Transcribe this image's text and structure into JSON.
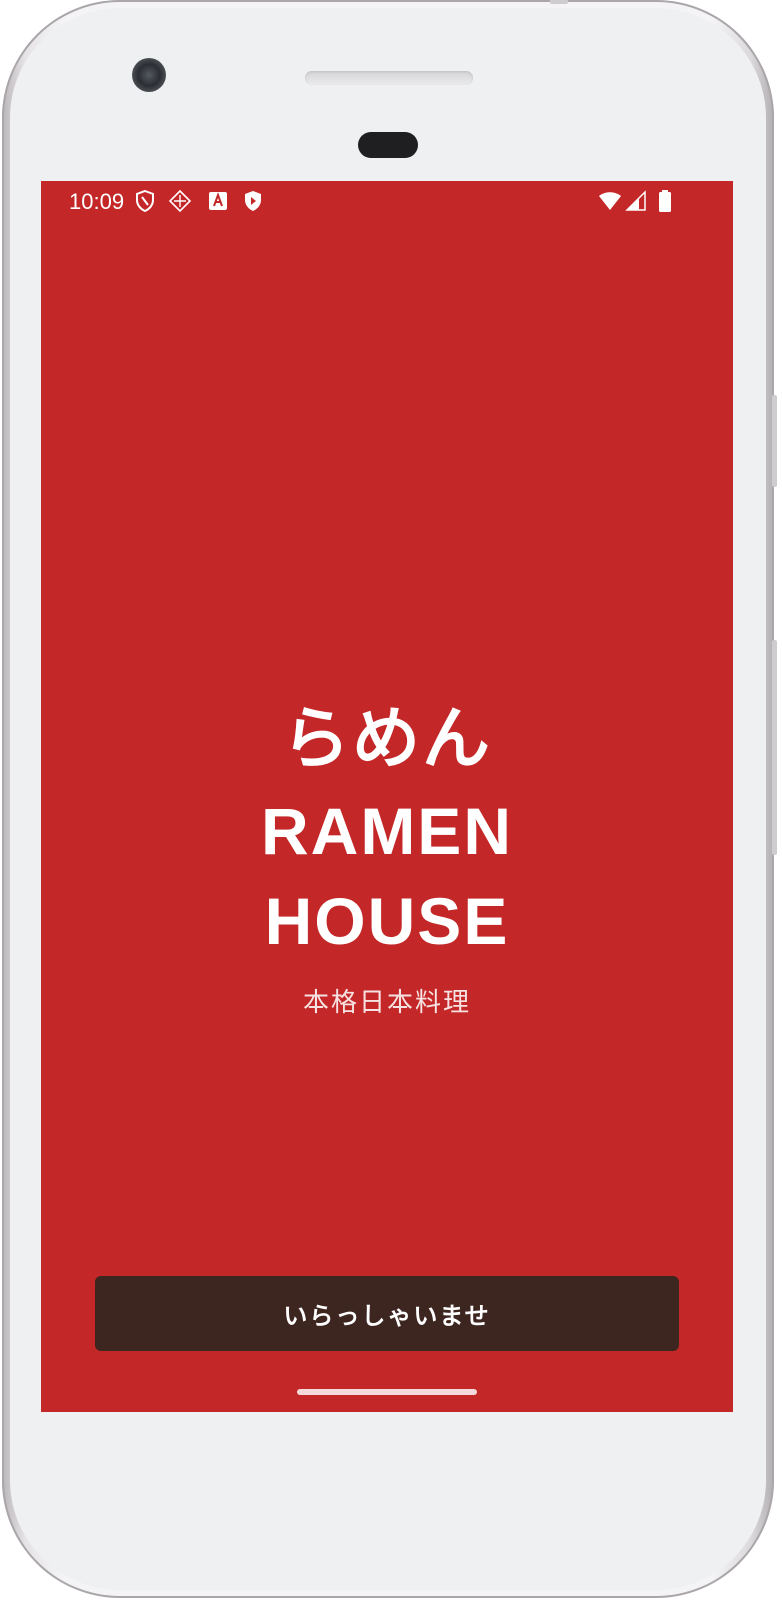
{
  "status_bar": {
    "time": "10:09",
    "icons_left": [
      "shield-outline-icon",
      "vpn-diamond-icon",
      "a-box-icon",
      "play-shield-icon"
    ],
    "icons_right": [
      "wifi-icon",
      "signal-icon",
      "battery-icon"
    ]
  },
  "splash": {
    "title_jp": "らめん",
    "title_en_line1": "RAMEN",
    "title_en_line2": "HOUSE",
    "subtitle": "本格日本料理"
  },
  "welcome_button": {
    "label": "いらっしゃいませ"
  },
  "colors": {
    "background": "#c42727",
    "button": "#3d2520",
    "text": "#ffffff"
  }
}
